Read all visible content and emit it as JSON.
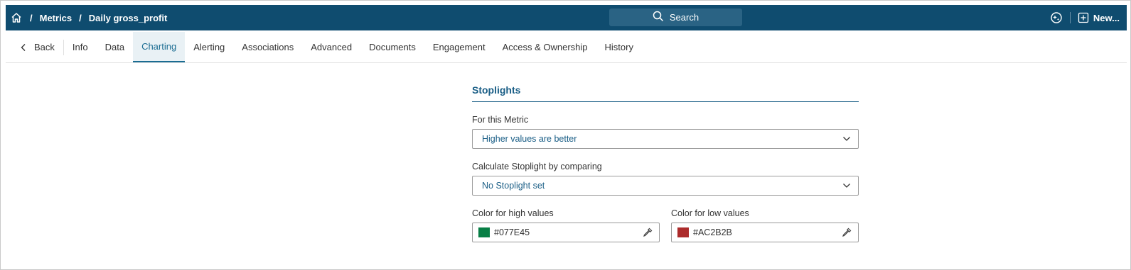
{
  "breadcrumb": {
    "items": [
      "Metrics",
      "Daily gross_profit"
    ]
  },
  "search": {
    "label": "Search"
  },
  "header": {
    "new_label": "New..."
  },
  "tabs": {
    "back": "Back",
    "items": [
      "Info",
      "Data",
      "Charting",
      "Alerting",
      "Associations",
      "Advanced",
      "Documents",
      "Engagement",
      "Access & Ownership",
      "History"
    ],
    "active": "Charting"
  },
  "stoplights": {
    "title": "Stoplights",
    "metric_label": "For this Metric",
    "metric_value": "Higher values are better",
    "compare_label": "Calculate Stoplight by comparing",
    "compare_value": "No Stoplight set",
    "high_label": "Color for high values",
    "high_value": "#077E45",
    "low_label": "Color for low values",
    "low_value": "#AC2B2B"
  },
  "colors": {
    "header_bg": "#0f4c6f",
    "accent": "#1a6c92",
    "high": "#077E45",
    "low": "#AC2B2B"
  }
}
